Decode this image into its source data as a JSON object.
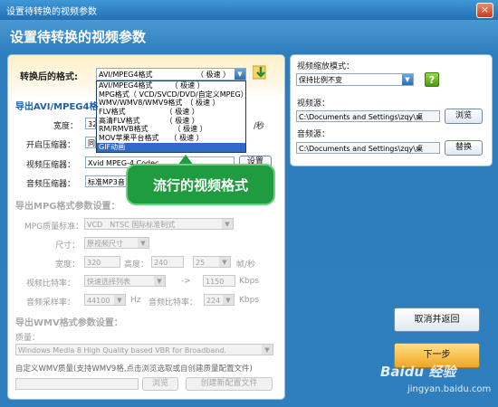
{
  "window": {
    "title": "设置待转换的视频参数",
    "close_label": "×"
  },
  "heading": "设置待转换的视频参数",
  "format_row": {
    "label": "转换后的格式:",
    "value": "AVI/MPEG4格式",
    "speed": "（ 极速 ）"
  },
  "format_options": [
    "AVI/MPEG4格式　　　（ 极速 ）",
    "MPG格式（ VCD/SVCD/DVD/自定义MPEG）",
    "WMV/WMV8/WMV9格式　（ 极速 ）",
    "FLV格式　　　　　　（ 极速 ）",
    "高清FLV格式　　　　（ 极速 ）",
    "RM/RMVB格式　　　　（ 极速 ）",
    "MOV苹果平台格式　　（ 极速 ）",
    "GIF动画"
  ],
  "avi_section": {
    "title": "导出AVI/MPEG4格",
    "width_label": "宽度：",
    "width_value": "320",
    "fps_suffix": "/秒",
    "open_compressor_label": "开启压缩器：",
    "open_compressor_value": "同",
    "video_compressor_label": "视频压缩器：",
    "video_compressor_value": "Xvid MPEG-4 Codec",
    "settings_button": "设置",
    "audio_compressor_label": "音频压缩器：",
    "audio_compressor_value": "标准MP3音"
  },
  "mpg_section": {
    "title": "导出MPG格式参数设置：",
    "quality_label": "MPG质量标准：",
    "quality_value": "VCD　NTSC 国际标准制式",
    "size_label": "尺寸：",
    "size_value": "原视频尺寸",
    "width_label": "宽度：",
    "width_value": "320",
    "height_label": "高度：",
    "height_value": "240",
    "fps_value": "25",
    "fps_unit": "帧/秒",
    "video_bitrate_label": "视频比特率：",
    "video_bitrate_value": "快速选择列表",
    "arrow": "->",
    "video_bitrate_num": "1150",
    "kbps1": "Kbps",
    "audio_sample_label": "音频采样率：",
    "audio_sample_value": "44100",
    "hz": "Hz",
    "audio_bitrate_label": "音频比特率：",
    "audio_bitrate_value": "224",
    "kbps2": "Kbps"
  },
  "wmv_section": {
    "title": "导出WMV格式参数设置：",
    "quality_label": "质量：",
    "quality_value": "Windows Media 8 High Quality based VBR for Broadband.",
    "custom_note": "自定义WMV质量(支持WMV9格,点击浏览选取或自创建质量配置文件)",
    "browse_button": "浏览",
    "create_button": "创建新配置文件"
  },
  "right_panel": {
    "scale_label": "视频缩放模式：",
    "scale_value": "保持比例不变",
    "help_label": "?",
    "video_source_label": "视频源：",
    "video_source_value": "C:\\Documents and Settings\\zqy\\桌",
    "browse_button": "浏览",
    "audio_source_label": "音频源：",
    "audio_source_value": "C:\\Documents and Settings\\zqy\\桌",
    "replace_button": "替换"
  },
  "buttons": {
    "cancel": "取消并返回",
    "next": "下一步"
  },
  "callout": "流行的视频格式",
  "watermark": {
    "brand": "Baidu 经验",
    "url": "jingyan.baidu.com"
  },
  "colors": {
    "accent": "#2e7dbd",
    "callout": "#1e9c3f",
    "next_button": "#f2a51f",
    "selected": "#3169c6"
  }
}
